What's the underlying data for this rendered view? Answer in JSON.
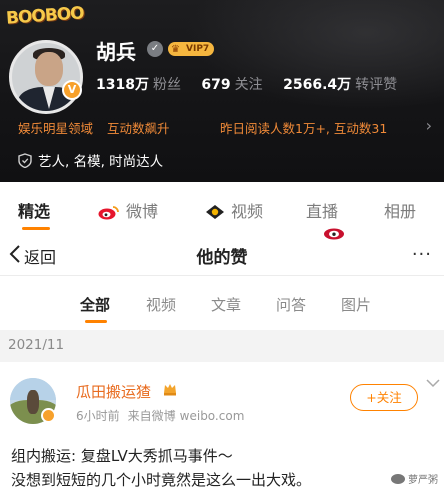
{
  "profile": {
    "sticker_text": "BOOBOO",
    "name": "胡兵",
    "vip_label": "VIP7",
    "vbadge": "V",
    "stats": [
      {
        "num": "1318万",
        "label": "粉丝"
      },
      {
        "num": "679",
        "label": "关注"
      },
      {
        "num": "2566.4万",
        "label": "转评赞"
      }
    ],
    "tag_a": "娱乐明星领域",
    "tag_b": "互动数飙升",
    "tag_c": "昨日阅读人数1万+, 互动数31",
    "cert": "艺人, 名模, 时尚达人"
  },
  "main_tabs": {
    "selected": "精选",
    "weibo": "微博",
    "video": "视频",
    "live": "直播",
    "album": "相册"
  },
  "overlay": {
    "back": "返回",
    "title": "他的赞",
    "more": "···",
    "sub_tabs": [
      "全部",
      "视频",
      "文章",
      "问答",
      "图片"
    ],
    "date": "2021/11"
  },
  "post": {
    "author": "瓜田搬运猹",
    "time": "6小时前",
    "source": "来自微博",
    "site": "weibo.com",
    "follow": "+关注",
    "line1": "组内搬运: 复盘LV大秀抓马事件～",
    "line2": "没想到短短的几个小时竟然是这么一出大戏。"
  },
  "watermark": "萝严粥",
  "colors": {
    "accent": "#ff8200",
    "header_bg": "#141416",
    "tag_orange": "#f08a38"
  }
}
